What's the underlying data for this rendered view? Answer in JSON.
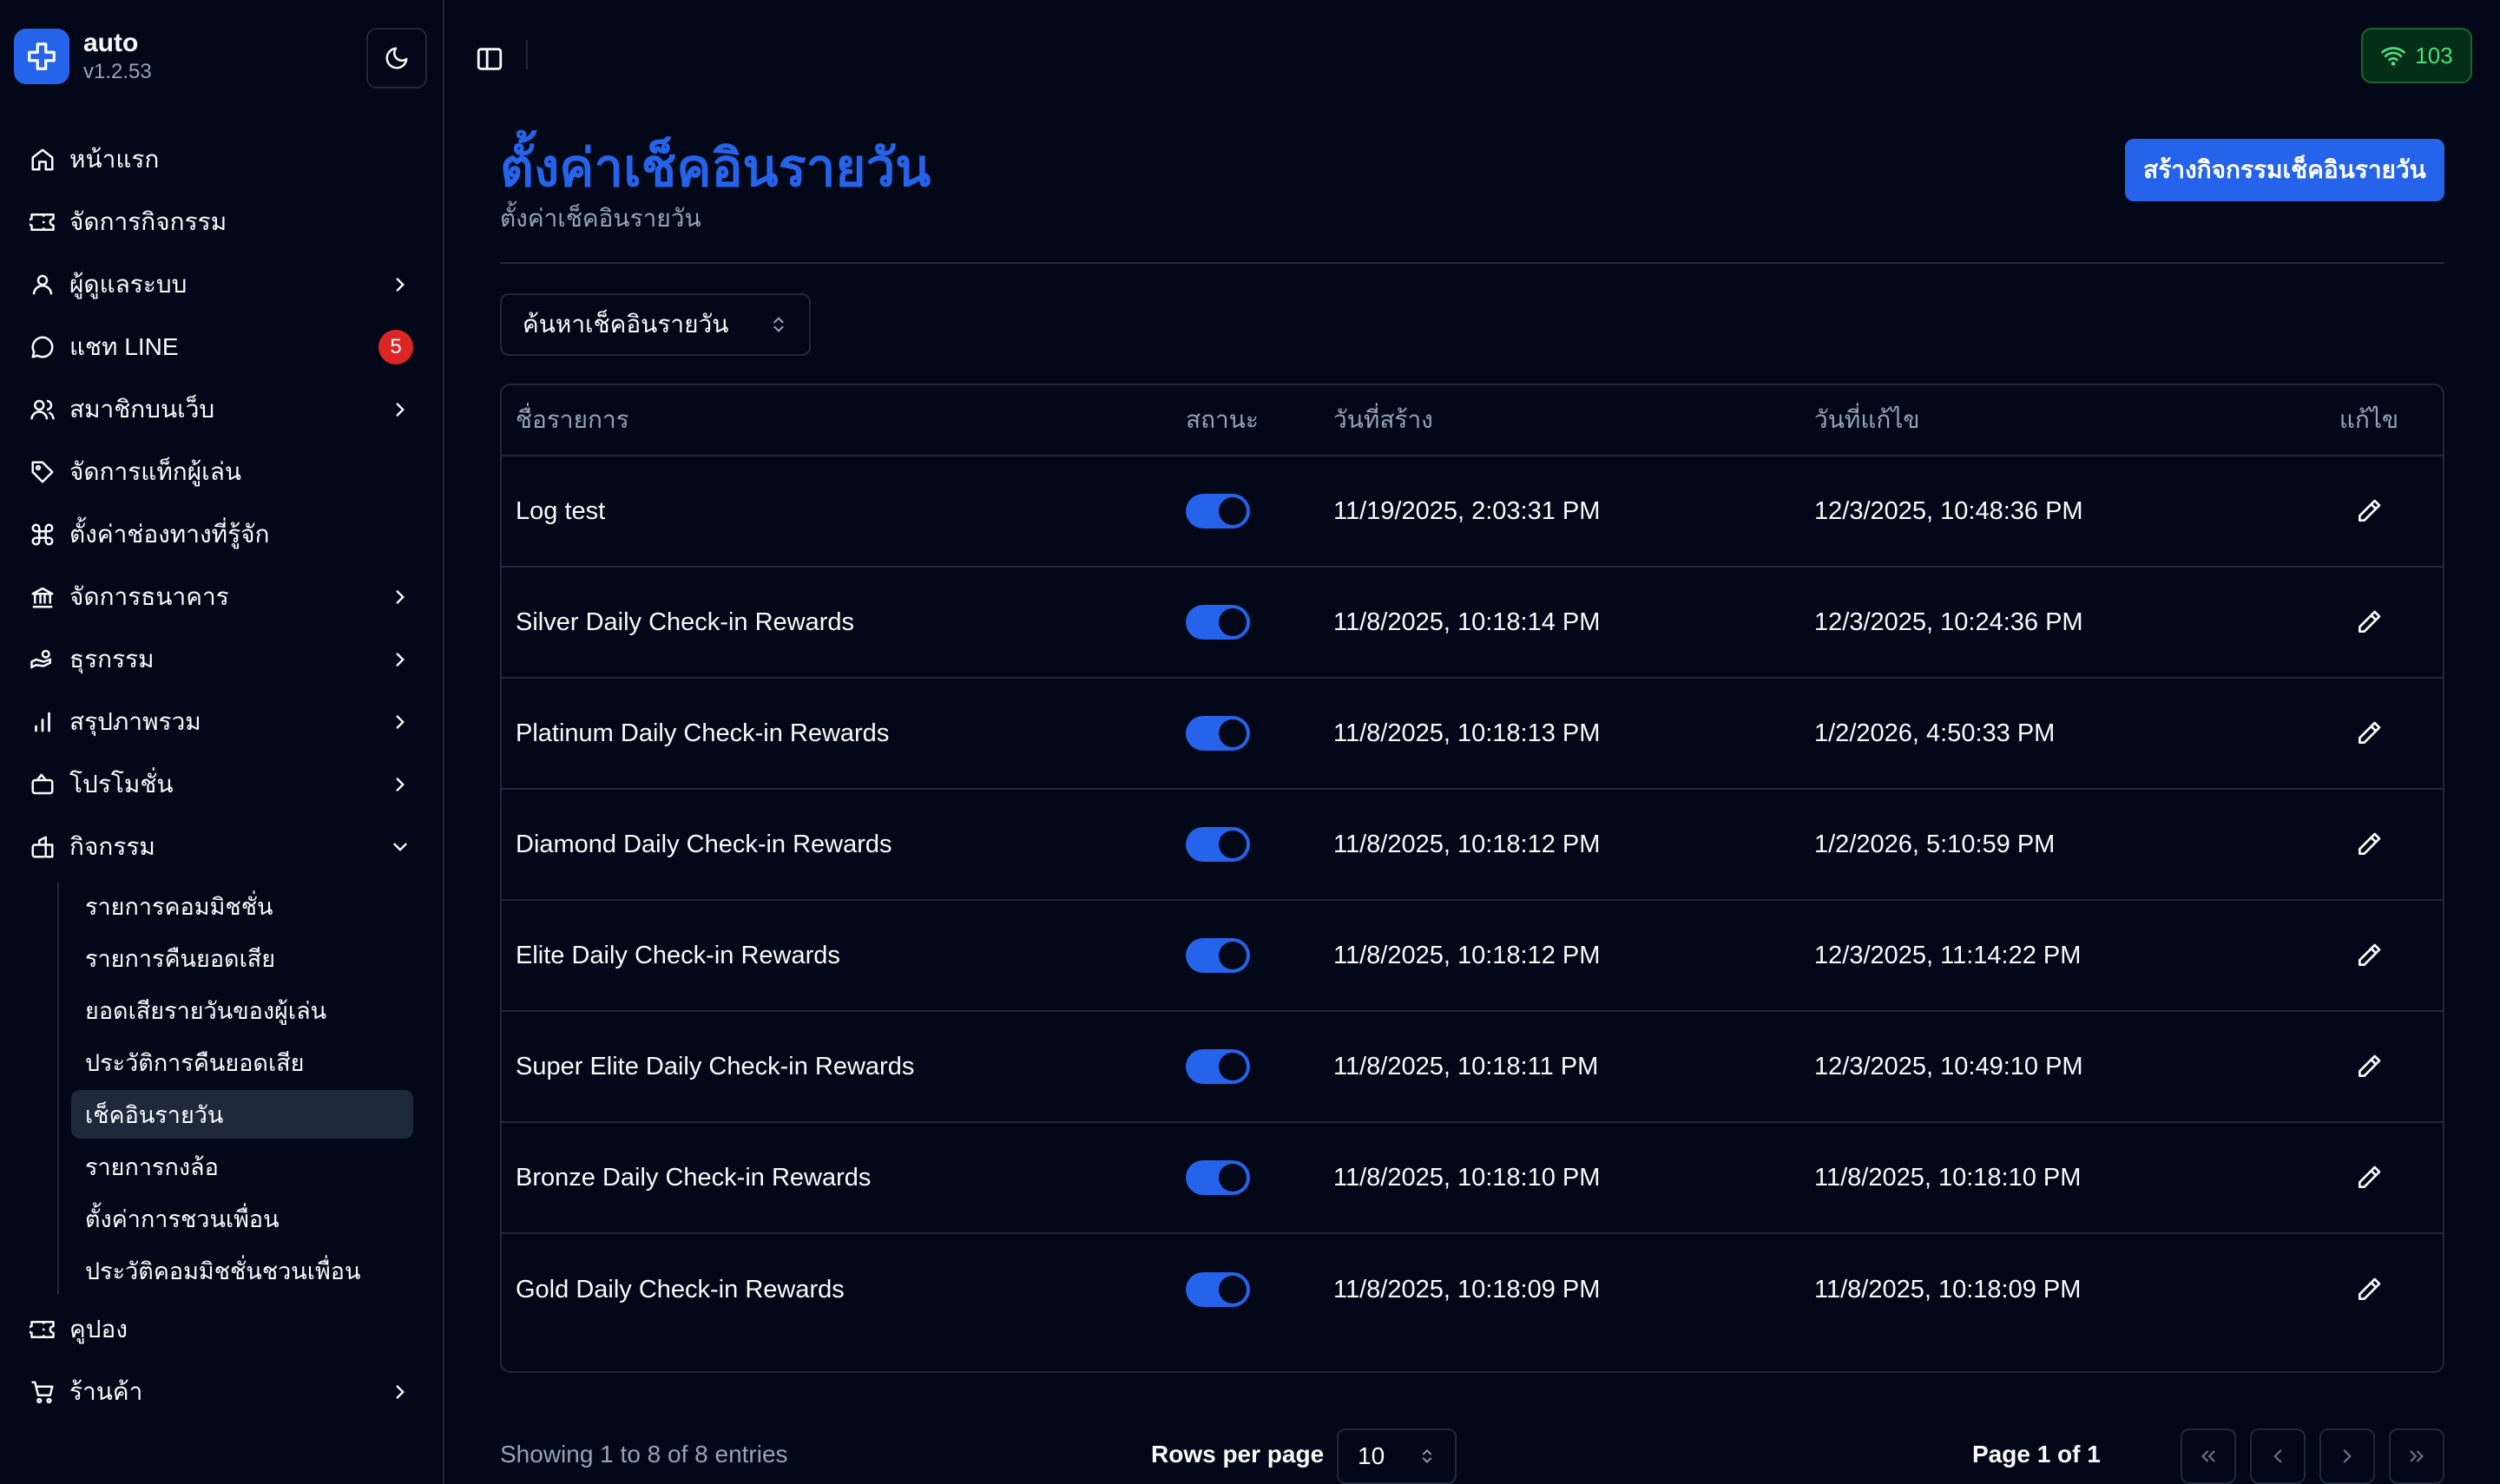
{
  "app": {
    "name": "auto",
    "version": "v1.2.53"
  },
  "status": {
    "value": "103"
  },
  "sidebar": {
    "items": [
      {
        "label": "หน้าแรก",
        "icon": "home-icon",
        "chevron": false
      },
      {
        "label": "จัดการกิจกรรม",
        "icon": "ticket-icon",
        "chevron": false
      },
      {
        "label": "ผู้ดูแลระบบ",
        "icon": "user-icon",
        "chevron": true
      },
      {
        "label": "แชท LINE",
        "icon": "chat-icon",
        "chevron": false,
        "badge": "5"
      },
      {
        "label": "สมาชิกบนเว็บ",
        "icon": "users-icon",
        "chevron": true
      },
      {
        "label": "จัดการแท็กผู้เล่น",
        "icon": "tag-icon",
        "chevron": false
      },
      {
        "label": "ตั้งค่าช่องทางที่รู้จัก",
        "icon": "command-icon",
        "chevron": false
      },
      {
        "label": "จัดการธนาคาร",
        "icon": "bank-icon",
        "chevron": true
      },
      {
        "label": "ธุรกรรม",
        "icon": "handcoins-icon",
        "chevron": true
      },
      {
        "label": "สรุปภาพรวม",
        "icon": "chart-icon",
        "chevron": true
      },
      {
        "label": "โปรโมชั่น",
        "icon": "promo-icon",
        "chevron": true
      },
      {
        "label": "กิจกรรม",
        "icon": "activity-icon",
        "chevron": true,
        "expanded": true
      }
    ],
    "sub_items": [
      {
        "label": "รายการคอมมิชชั่น",
        "active": false
      },
      {
        "label": "รายการคืนยอดเสีย",
        "active": false
      },
      {
        "label": "ยอดเสียรายวันของผู้เล่น",
        "active": false
      },
      {
        "label": "ประวัติการคืนยอดเสีย",
        "active": false
      },
      {
        "label": "เช็คอินรายวัน",
        "active": true
      },
      {
        "label": "รายการกงล้อ",
        "active": false
      },
      {
        "label": "ตั้งค่าการชวนเพื่อน",
        "active": false
      },
      {
        "label": "ประวัติคอมมิชชั่นชวนเพื่อน",
        "active": false
      }
    ],
    "bottom_items": [
      {
        "label": "คูปอง",
        "icon": "coupon-icon",
        "chevron": false
      },
      {
        "label": "ร้านค้า",
        "icon": "cart-icon",
        "chevron": true
      }
    ]
  },
  "page": {
    "title": "ตั้งค่าเช็คอินรายวัน",
    "subtitle": "ตั้งค่าเช็คอินรายวัน",
    "create_button": "สร้างกิจกรรมเช็คอินรายวัน",
    "filter_placeholder": "ค้นหาเช็คอินรายวัน"
  },
  "table": {
    "headers": {
      "name": "ชื่อรายการ",
      "status": "สถานะ",
      "created": "วันที่สร้าง",
      "updated": "วันที่แก้ไข",
      "edit": "แก้ไข"
    },
    "rows": [
      {
        "name": "Log test",
        "enabled": true,
        "created": "11/19/2025, 2:03:31 PM",
        "updated": "12/3/2025, 10:48:36 PM"
      },
      {
        "name": "Silver Daily Check-in Rewards",
        "enabled": true,
        "created": "11/8/2025, 10:18:14 PM",
        "updated": "12/3/2025, 10:24:36 PM"
      },
      {
        "name": "Platinum Daily Check-in Rewards",
        "enabled": true,
        "created": "11/8/2025, 10:18:13 PM",
        "updated": "1/2/2026, 4:50:33 PM"
      },
      {
        "name": "Diamond Daily Check-in Rewards",
        "enabled": true,
        "created": "11/8/2025, 10:18:12 PM",
        "updated": "1/2/2026, 5:10:59 PM"
      },
      {
        "name": "Elite Daily Check-in Rewards",
        "enabled": true,
        "created": "11/8/2025, 10:18:12 PM",
        "updated": "12/3/2025, 11:14:22 PM"
      },
      {
        "name": "Super Elite Daily Check-in Rewards",
        "enabled": true,
        "created": "11/8/2025, 10:18:11 PM",
        "updated": "12/3/2025, 10:49:10 PM"
      },
      {
        "name": "Bronze Daily Check-in Rewards",
        "enabled": true,
        "created": "11/8/2025, 10:18:10 PM",
        "updated": "11/8/2025, 10:18:10 PM"
      },
      {
        "name": "Gold Daily Check-in Rewards",
        "enabled": true,
        "created": "11/8/2025, 10:18:09 PM",
        "updated": "11/8/2025, 10:18:09 PM"
      }
    ]
  },
  "pagination": {
    "showing": "Showing 1 to 8 of 8 entries",
    "rows_label": "Rows per page",
    "rows_value": "10",
    "page_info": "Page 1 of 1"
  },
  "colors": {
    "accent": "#2563eb",
    "background": "#020817",
    "border": "#1e293b",
    "muted": "#94a3b8",
    "badge": "#dc2626",
    "online": "#4ade80"
  }
}
